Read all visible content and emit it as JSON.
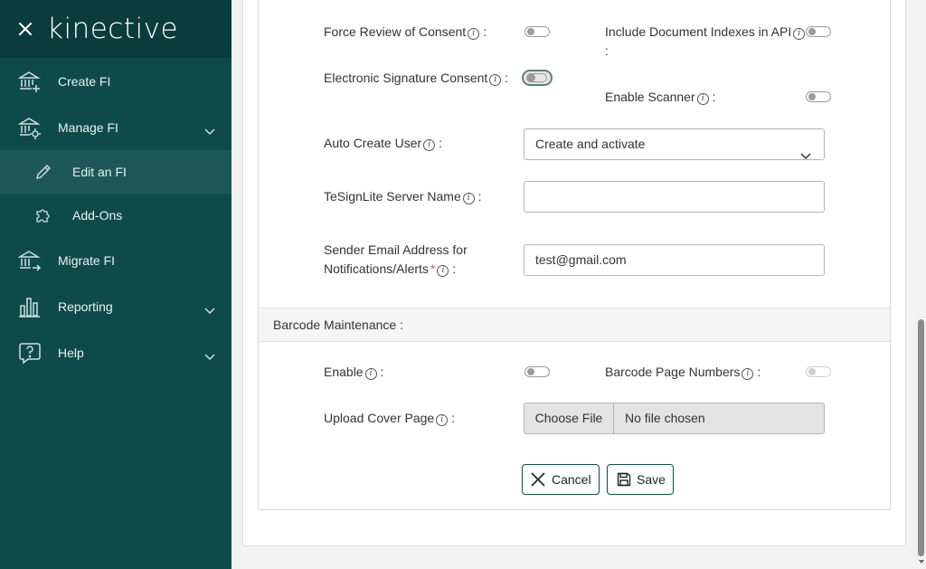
{
  "sidebar": {
    "logo": "kinective",
    "items": [
      {
        "label": "Create FI",
        "icon": "bank-plus-icon"
      },
      {
        "label": "Manage FI",
        "icon": "bank-gear-icon"
      },
      {
        "label": "Edit an FI",
        "icon": "pencil-icon"
      },
      {
        "label": "Add-Ons",
        "icon": "puzzle-icon"
      },
      {
        "label": "Migrate FI",
        "icon": "bank-arrow-icon"
      },
      {
        "label": "Reporting",
        "icon": "bar-chart-icon"
      },
      {
        "label": "Help",
        "icon": "question-bubble-icon"
      }
    ]
  },
  "form": {
    "force_review_label": "Force Review of Consent",
    "include_doc_indexes_label": "Include Document Indexes in API",
    "esign_consent_label": "Electronic Signature Consent",
    "enable_scanner_label": "Enable Scanner",
    "auto_create_user_label": "Auto Create User",
    "auto_create_user_value": "Create and activate",
    "tesign_server_label": "TeSignLite Server Name",
    "tesign_server_value": "",
    "sender_email_label_line1": "Sender Email Address for",
    "sender_email_label_line2": "Notifications/Alerts",
    "sender_email_value": "test@gmail.com",
    "colon": ":",
    "required_mark": "*",
    "info_glyph": "i"
  },
  "barcode": {
    "section_title": "Barcode Maintenance :",
    "enable_label": "Enable",
    "page_numbers_label": "Barcode Page Numbers",
    "upload_cover_label": "Upload Cover Page",
    "choose_file": "Choose File",
    "no_file": "No file chosen"
  },
  "actions": {
    "cancel": "Cancel",
    "save": "Save"
  },
  "colors": {
    "sidebar_bg": "#0f4a4b",
    "sidebar_header_bg": "#0b3c3d",
    "active_item_bg": "#1d5758",
    "required": "#d9534f"
  }
}
